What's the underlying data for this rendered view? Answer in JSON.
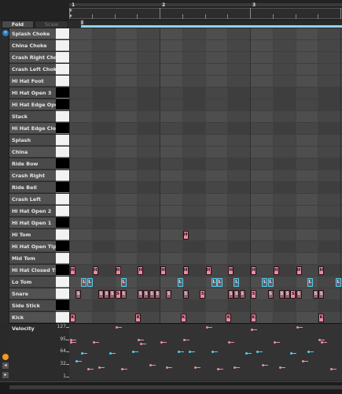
{
  "ruler": {
    "bars": [
      "1",
      "2",
      "3"
    ]
  },
  "controls": {
    "fold_label": "Fold",
    "scale_label": "Scale"
  },
  "rows": [
    {
      "label": "Splash Choke",
      "key": "white"
    },
    {
      "label": "China Choke",
      "key": "white"
    },
    {
      "label": "Crash Right Choke",
      "key": "white"
    },
    {
      "label": "Crash Left Choke",
      "key": "white"
    },
    {
      "label": "Hi Hat Foot",
      "key": "white"
    },
    {
      "label": "Hi Hat Open 3",
      "key": "black"
    },
    {
      "label": "Hi Hat Edge Open",
      "key": "black"
    },
    {
      "label": "Stack",
      "key": "white"
    },
    {
      "label": "Hi Hat Edge Closed",
      "key": "black"
    },
    {
      "label": "Splash",
      "key": "white"
    },
    {
      "label": "China",
      "key": "white"
    },
    {
      "label": "Ride Bow",
      "key": "black"
    },
    {
      "label": "Crash Right",
      "key": "white"
    },
    {
      "label": "Ride Bell",
      "key": "black"
    },
    {
      "label": "Crash Left",
      "key": "white"
    },
    {
      "label": "Hi Hat Open 2",
      "key": "white"
    },
    {
      "label": "Hi Hat Open 1",
      "key": "black"
    },
    {
      "label": "Hi Tom",
      "key": "white"
    },
    {
      "label": "Hi Hat Open Tip",
      "key": "black"
    },
    {
      "label": "Mid Tom",
      "key": "white"
    },
    {
      "label": "Hi Hat Closed Tip",
      "key": "black"
    },
    {
      "label": "Lo Tom",
      "key": "white"
    },
    {
      "label": "Snare",
      "key": "white"
    },
    {
      "label": "Side Stick",
      "key": "black"
    },
    {
      "label": "Kick",
      "key": "white"
    }
  ],
  "note_letters": {
    "Hi Tom": "H",
    "Hi Hat Closed Tip": "H",
    "Lo Tom": "L",
    "Snare": "S",
    "Kick": "K"
  },
  "notes": {
    "Hi Tom": [
      {
        "beat": 5.0
      }
    ],
    "Hi Hat Closed Tip": [
      {
        "beat": 0.0
      },
      {
        "beat": 1.0
      },
      {
        "beat": 2.0
      },
      {
        "beat": 3.0
      },
      {
        "beat": 4.0
      },
      {
        "beat": 5.0
      },
      {
        "beat": 6.0
      },
      {
        "beat": 7.0
      },
      {
        "beat": 8.0
      },
      {
        "beat": 9.0
      },
      {
        "beat": 10.0
      },
      {
        "beat": 11.0
      }
    ],
    "Lo Tom": [
      {
        "beat": 0.5,
        "sel": true
      },
      {
        "beat": 0.75,
        "sel": true
      },
      {
        "beat": 2.25,
        "sel": true
      },
      {
        "beat": 4.75,
        "sel": true
      },
      {
        "beat": 6.25,
        "sel": true
      },
      {
        "beat": 6.5,
        "sel": true
      },
      {
        "beat": 7.25,
        "sel": true
      },
      {
        "beat": 8.5,
        "sel": true
      },
      {
        "beat": 8.75,
        "sel": true
      },
      {
        "beat": 10.5,
        "sel": true
      },
      {
        "beat": 11.75,
        "sel": true
      }
    ],
    "Snare": [
      {
        "beat": 0.25,
        "dark": true
      },
      {
        "beat": 1.25,
        "dark": true
      },
      {
        "beat": 1.5,
        "dark": true
      },
      {
        "beat": 1.75,
        "dark": true
      },
      {
        "beat": 2.0
      },
      {
        "beat": 2.25,
        "dark": true
      },
      {
        "beat": 3.0,
        "dark": true
      },
      {
        "beat": 3.25,
        "dark": true
      },
      {
        "beat": 3.5,
        "dark": true
      },
      {
        "beat": 3.75,
        "dark": true
      },
      {
        "beat": 4.25,
        "dark": true
      },
      {
        "beat": 5.0,
        "dark": true
      },
      {
        "beat": 5.75
      },
      {
        "beat": 7.0,
        "dark": true
      },
      {
        "beat": 7.25,
        "dark": true
      },
      {
        "beat": 7.5,
        "dark": true
      },
      {
        "beat": 8.0
      },
      {
        "beat": 8.75,
        "dark": true
      },
      {
        "beat": 9.25,
        "dark": true
      },
      {
        "beat": 9.5,
        "dark": true
      },
      {
        "beat": 9.75
      },
      {
        "beat": 10.0,
        "dark": true
      },
      {
        "beat": 10.75,
        "dark": true
      },
      {
        "beat": 11.0,
        "dark": true
      }
    ],
    "Kick": [
      {
        "beat": 0.0
      },
      {
        "beat": 2.9
      },
      {
        "beat": 4.9
      },
      {
        "beat": 6.9
      },
      {
        "beat": 8.0
      },
      {
        "beat": 11.0
      }
    ]
  },
  "velocity": {
    "title": "Velocity",
    "axis_labels": [
      "127",
      "95",
      "64",
      "32",
      "1"
    ],
    "max": 127,
    "stems": [
      {
        "beat": 0.0,
        "v": 95,
        "c": "pink"
      },
      {
        "beat": 0.0,
        "v": 88,
        "c": "pink"
      },
      {
        "beat": 0.25,
        "v": 40,
        "c": "cyan"
      },
      {
        "beat": 0.5,
        "v": 60,
        "c": "cyan"
      },
      {
        "beat": 0.75,
        "v": 20,
        "c": "pink"
      },
      {
        "beat": 1.0,
        "v": 88,
        "c": "pink"
      },
      {
        "beat": 1.25,
        "v": 25,
        "c": "pink"
      },
      {
        "beat": 1.75,
        "v": 60,
        "c": "cyan"
      },
      {
        "beat": 2.0,
        "v": 127,
        "c": "pink"
      },
      {
        "beat": 2.25,
        "v": 20,
        "c": "pink"
      },
      {
        "beat": 2.75,
        "v": 64,
        "c": "cyan"
      },
      {
        "beat": 3.0,
        "v": 95,
        "c": "pink"
      },
      {
        "beat": 3.1,
        "v": 85,
        "c": "pink"
      },
      {
        "beat": 3.5,
        "v": 30,
        "c": "pink"
      },
      {
        "beat": 4.0,
        "v": 88,
        "c": "pink"
      },
      {
        "beat": 4.25,
        "v": 25,
        "c": "pink"
      },
      {
        "beat": 4.75,
        "v": 64,
        "c": "cyan"
      },
      {
        "beat": 5.0,
        "v": 95,
        "c": "pink"
      },
      {
        "beat": 5.25,
        "v": 64,
        "c": "cyan"
      },
      {
        "beat": 5.5,
        "v": 25,
        "c": "pink"
      },
      {
        "beat": 6.0,
        "v": 127,
        "c": "pink"
      },
      {
        "beat": 6.25,
        "v": 64,
        "c": "cyan"
      },
      {
        "beat": 6.5,
        "v": 20,
        "c": "pink"
      },
      {
        "beat": 7.0,
        "v": 88,
        "c": "pink"
      },
      {
        "beat": 7.25,
        "v": 25,
        "c": "pink"
      },
      {
        "beat": 7.75,
        "v": 60,
        "c": "cyan"
      },
      {
        "beat": 8.0,
        "v": 120,
        "c": "pink"
      },
      {
        "beat": 8.25,
        "v": 64,
        "c": "cyan"
      },
      {
        "beat": 8.5,
        "v": 30,
        "c": "pink"
      },
      {
        "beat": 9.0,
        "v": 88,
        "c": "pink"
      },
      {
        "beat": 9.25,
        "v": 25,
        "c": "pink"
      },
      {
        "beat": 9.75,
        "v": 60,
        "c": "cyan"
      },
      {
        "beat": 10.0,
        "v": 127,
        "c": "pink"
      },
      {
        "beat": 10.25,
        "v": 40,
        "c": "pink"
      },
      {
        "beat": 10.5,
        "v": 64,
        "c": "cyan"
      },
      {
        "beat": 11.0,
        "v": 95,
        "c": "pink"
      },
      {
        "beat": 11.1,
        "v": 88,
        "c": "pink"
      },
      {
        "beat": 11.5,
        "v": 20,
        "c": "pink"
      }
    ]
  },
  "colors": {
    "note": "#e98ca0",
    "note_dark": "#8f6470",
    "selection": "#4fd0ef",
    "velocity_pink": "#e98ca0",
    "velocity_cyan": "#4fd0ef",
    "loop_brace": "#8fd3ef",
    "accent_orange": "#f39a1f"
  }
}
